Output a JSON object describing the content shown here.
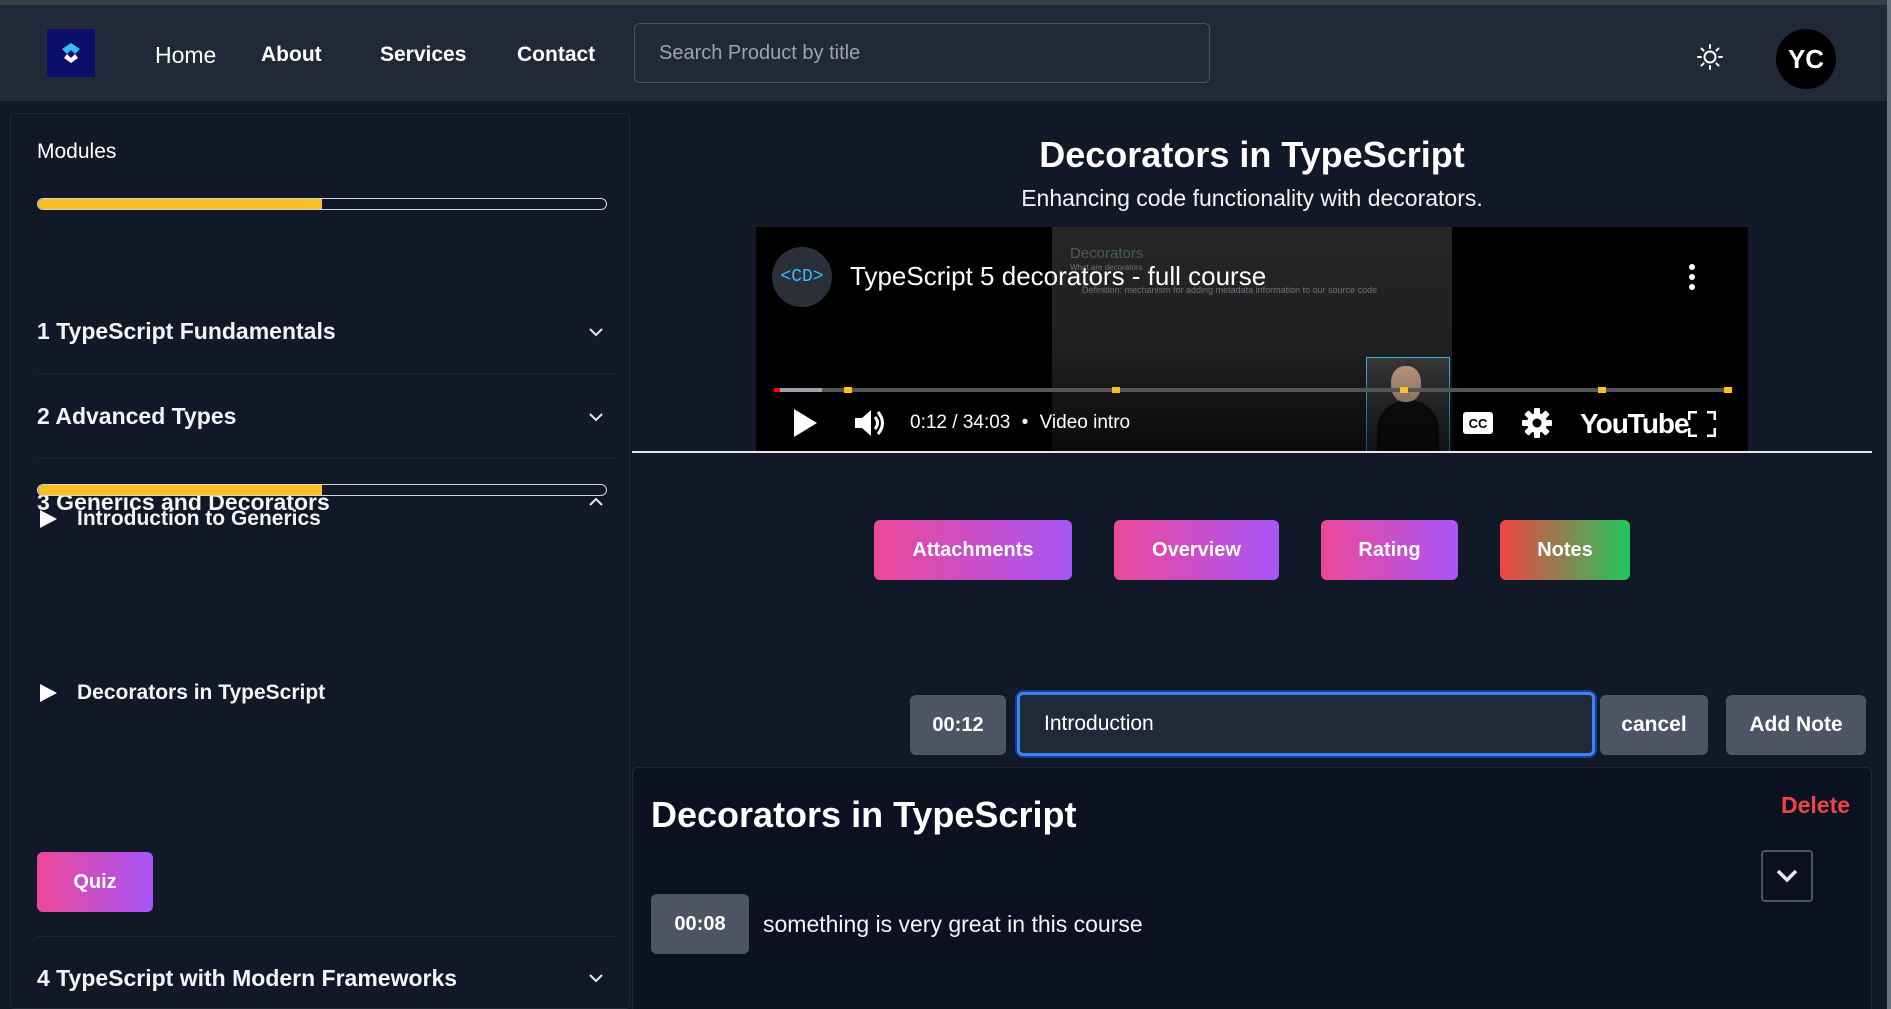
{
  "header": {
    "logo_alt": "Code Mentor",
    "nav": {
      "home": "Home",
      "about": "About",
      "services": "Services",
      "contact": "Contact"
    },
    "search_placeholder": "Search Product by title",
    "avatar_initials": "YC",
    "theme_icon": "sun-icon"
  },
  "sidebar": {
    "title": "Modules",
    "overall_progress": 0.5,
    "modules": [
      {
        "label": "1 TypeScript Fundamentals",
        "expanded": false
      },
      {
        "label": "2 Advanced Types",
        "expanded": false
      },
      {
        "label": "3 Generics and Decorators",
        "expanded": true,
        "progress": 0.5
      },
      {
        "label": "4 TypeScript with Modern Frameworks",
        "expanded": false
      }
    ],
    "lessons": [
      {
        "label": "Introduction to Generics"
      },
      {
        "label": "Decorators in TypeScript"
      }
    ],
    "quiz_label": "Quiz"
  },
  "main": {
    "title": "Decorators in TypeScript",
    "subtitle": "Enhancing code functionality with decorators.",
    "video": {
      "channel_badge": "<CD>",
      "title": "TypeScript 5 decorators - full course",
      "time": "0:12 / 34:03",
      "chapter": "Video intro",
      "separator": "•",
      "brand": "YouTube",
      "slide_heading": "Decorators",
      "slide_sub": "What are decorators",
      "slide_bullet": "Definition: mechanism for adding metadata information to our source code",
      "played_fraction": 0.006,
      "buffered_fraction": 0.05
    },
    "tabs": {
      "attachments": "Attachments",
      "overview": "Overview",
      "rating": "Rating",
      "notes": "Notes"
    },
    "note_editor": {
      "timestamp": "00:12",
      "value": "Introduction",
      "cancel_label": "cancel",
      "add_label": "Add Note"
    },
    "note_card": {
      "title": "Decorators in TypeScript",
      "delete_label": "Delete",
      "entry_time": "00:08",
      "entry_text": "something is very great in this course"
    }
  },
  "colors": {
    "background": "#111827",
    "header": "#1f2937",
    "progress": "#fbbf24",
    "accent_gradient": [
      "#ec4899",
      "#a855f7"
    ],
    "notes_gradient": [
      "#ef4444",
      "#22c55e"
    ],
    "delete": "#ef4444",
    "focus": "#3b82f6"
  }
}
